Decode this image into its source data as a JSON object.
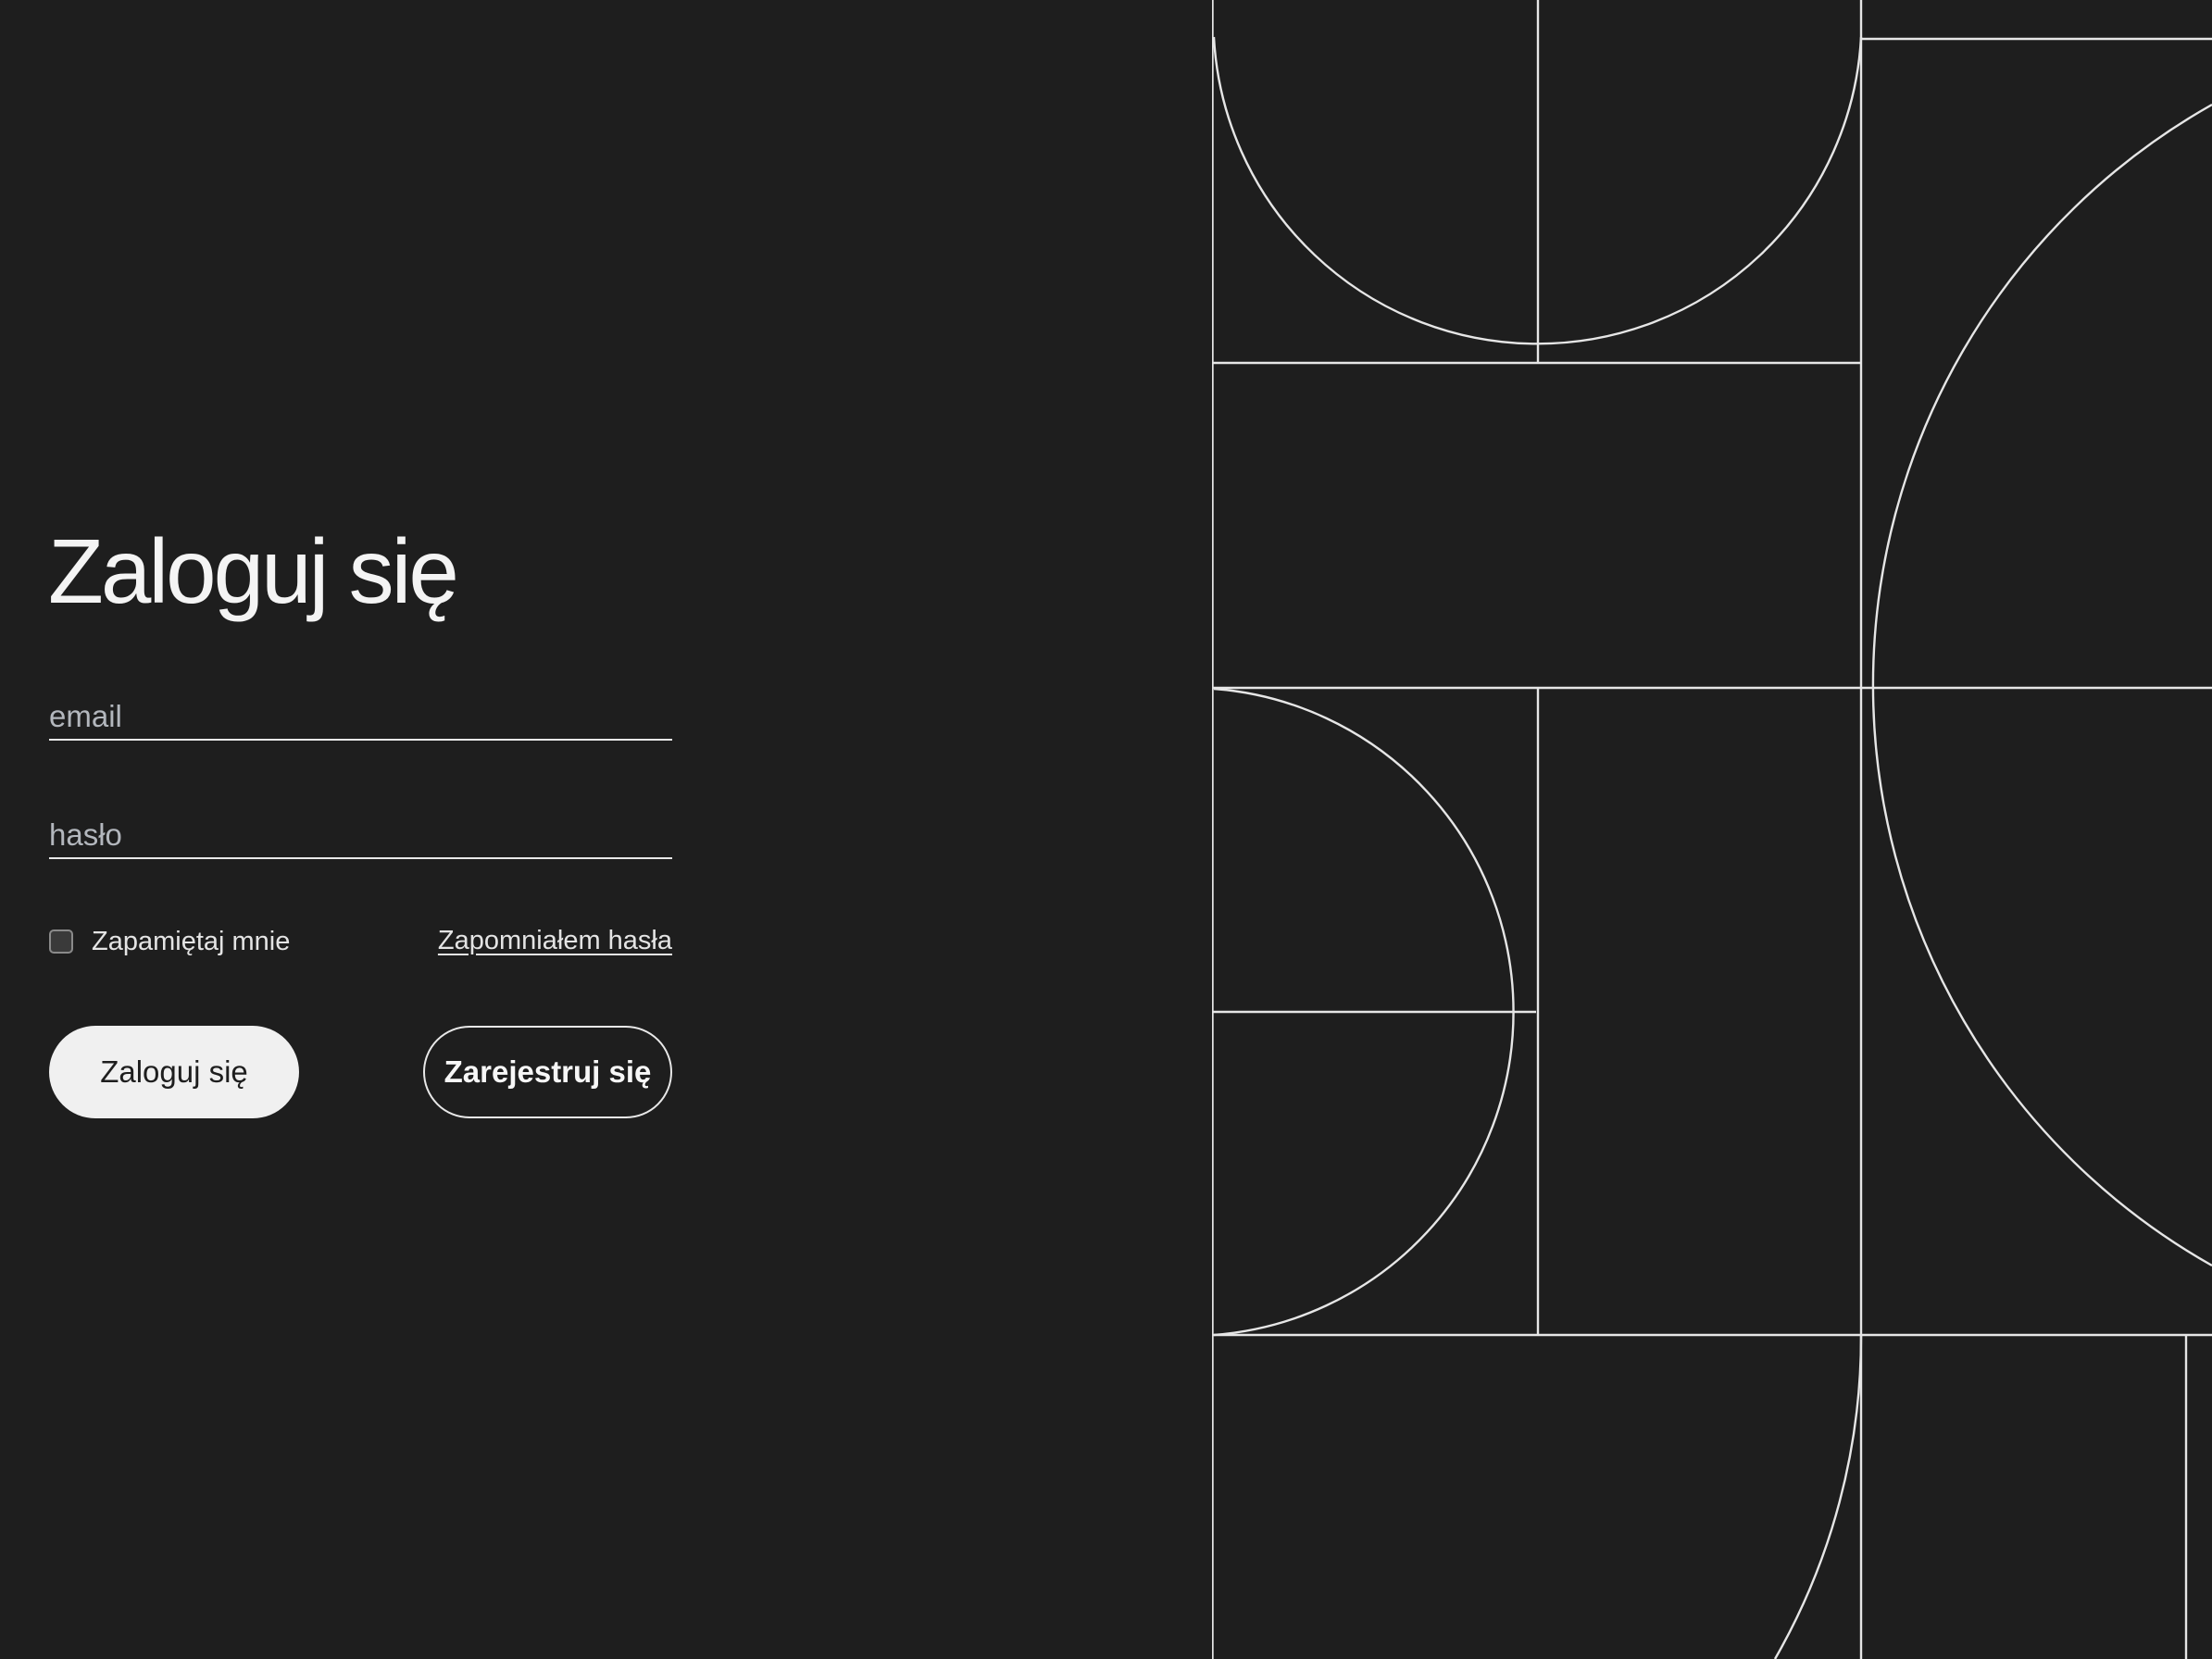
{
  "login": {
    "title": "Zaloguj się",
    "email_placeholder": "email",
    "password_placeholder": "hasło",
    "remember_label": "Zapamiętaj mnie",
    "remember_checked": false,
    "forgot_label": "Zapomniałem hasła",
    "login_button_label": "Zaloguj się",
    "register_button_label": "Zarejestruj się"
  },
  "colors": {
    "background": "#1e1e1e",
    "foreground": "#f0f0f0",
    "placeholder": "#b3b7bd",
    "pattern_stroke": "#e6e6e6"
  }
}
